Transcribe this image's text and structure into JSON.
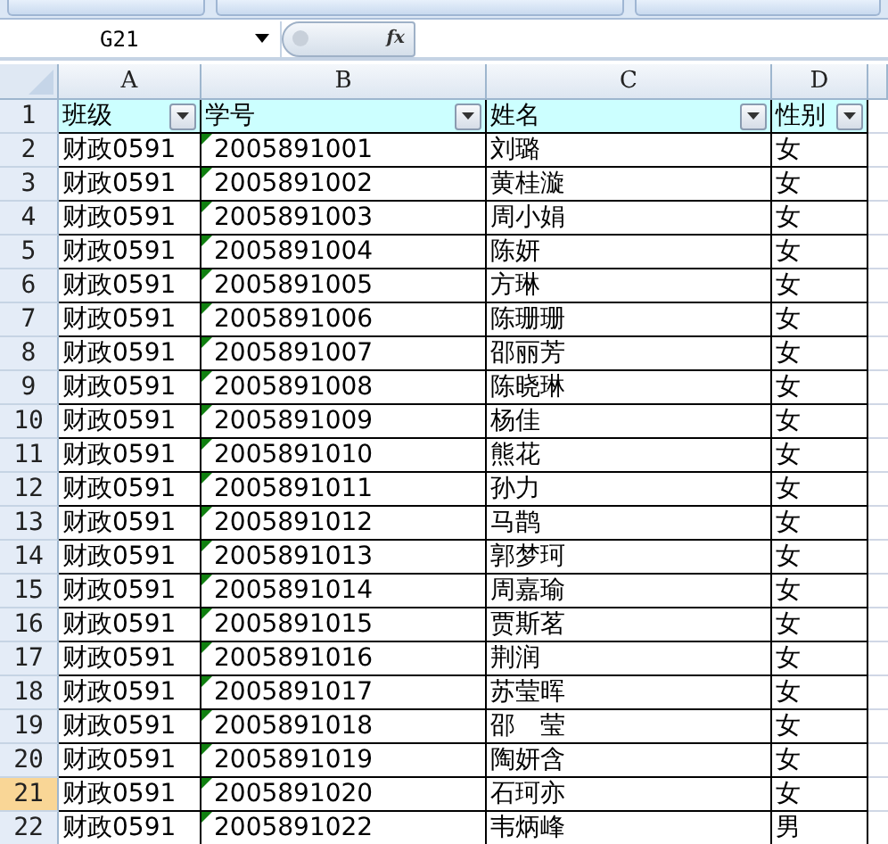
{
  "formula_bar": {
    "name_box": "G21",
    "fx": "fx"
  },
  "columns": [
    {
      "label": "A",
      "selected": false
    },
    {
      "label": "B",
      "selected": false
    },
    {
      "label": "C",
      "selected": false
    },
    {
      "label": "D",
      "selected": false
    }
  ],
  "header_row": {
    "number": "1",
    "cells": [
      "班级",
      "学号",
      "姓名",
      "性别"
    ]
  },
  "rows": [
    {
      "number": "2",
      "selected": false,
      "cells": [
        "财政0591",
        "2005891001",
        "刘璐",
        "女"
      ]
    },
    {
      "number": "3",
      "selected": false,
      "cells": [
        "财政0591",
        "2005891002",
        "黄桂漩",
        "女"
      ]
    },
    {
      "number": "4",
      "selected": false,
      "cells": [
        "财政0591",
        "2005891003",
        "周小娟",
        "女"
      ]
    },
    {
      "number": "5",
      "selected": false,
      "cells": [
        "财政0591",
        "2005891004",
        "陈妍",
        "女"
      ]
    },
    {
      "number": "6",
      "selected": false,
      "cells": [
        "财政0591",
        "2005891005",
        "方琳",
        "女"
      ]
    },
    {
      "number": "7",
      "selected": false,
      "cells": [
        "财政0591",
        "2005891006",
        "陈珊珊",
        "女"
      ]
    },
    {
      "number": "8",
      "selected": false,
      "cells": [
        "财政0591",
        "2005891007",
        "邵丽芳",
        "女"
      ]
    },
    {
      "number": "9",
      "selected": false,
      "cells": [
        "财政0591",
        "2005891008",
        "陈晓琳",
        "女"
      ]
    },
    {
      "number": "10",
      "selected": false,
      "cells": [
        "财政0591",
        "2005891009",
        "杨佳",
        "女"
      ]
    },
    {
      "number": "11",
      "selected": false,
      "cells": [
        "财政0591",
        "2005891010",
        "熊花",
        "女"
      ]
    },
    {
      "number": "12",
      "selected": false,
      "cells": [
        "财政0591",
        "2005891011",
        "孙力",
        "女"
      ]
    },
    {
      "number": "13",
      "selected": false,
      "cells": [
        "财政0591",
        "2005891012",
        "马鹊",
        "女"
      ]
    },
    {
      "number": "14",
      "selected": false,
      "cells": [
        "财政0591",
        "2005891013",
        "郭梦珂",
        "女"
      ]
    },
    {
      "number": "15",
      "selected": false,
      "cells": [
        "财政0591",
        "2005891014",
        "周嘉瑜",
        "女"
      ]
    },
    {
      "number": "16",
      "selected": false,
      "cells": [
        "财政0591",
        "2005891015",
        "贾斯茗",
        "女"
      ]
    },
    {
      "number": "17",
      "selected": false,
      "cells": [
        "财政0591",
        "2005891016",
        "荆润",
        "女"
      ]
    },
    {
      "number": "18",
      "selected": false,
      "cells": [
        "财政0591",
        "2005891017",
        "苏莹晖",
        "女"
      ]
    },
    {
      "number": "19",
      "selected": false,
      "cells": [
        "财政0591",
        "2005891018",
        "邵　莹",
        "女"
      ]
    },
    {
      "number": "20",
      "selected": false,
      "cells": [
        "财政0591",
        "2005891019",
        "陶妍含",
        "女"
      ]
    },
    {
      "number": "21",
      "selected": true,
      "cells": [
        "财政0591",
        "2005891020",
        "石珂亦",
        "女"
      ]
    },
    {
      "number": "22",
      "selected": false,
      "cells": [
        "财政0591",
        "2005891022",
        "韦炳峰",
        "男"
      ]
    }
  ]
}
